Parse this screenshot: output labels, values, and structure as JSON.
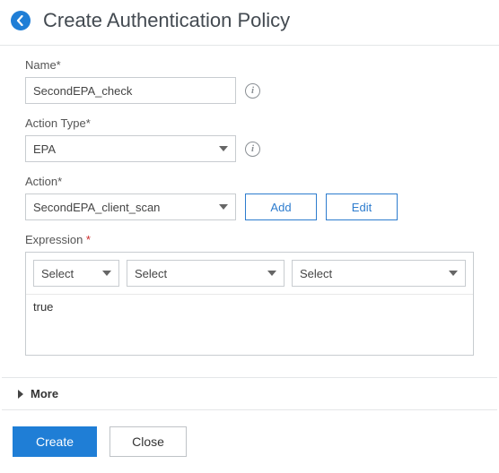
{
  "header": {
    "title": "Create Authentication Policy"
  },
  "fields": {
    "name": {
      "label": "Name*",
      "value": "SecondEPA_check"
    },
    "action_type": {
      "label": "Action Type*",
      "selected": "EPA",
      "options": [
        "EPA"
      ]
    },
    "action": {
      "label": "Action*",
      "selected": "SecondEPA_client_scan",
      "options": [
        "SecondEPA_client_scan"
      ],
      "add_btn": "Add",
      "edit_btn": "Edit"
    }
  },
  "expression": {
    "label": "Expression ",
    "sel1": {
      "placeholder": "Select",
      "options": [
        "Select"
      ]
    },
    "sel2": {
      "placeholder": "Select",
      "options": [
        "Select"
      ]
    },
    "sel3": {
      "placeholder": "Select",
      "options": [
        "Select"
      ]
    },
    "text": "true"
  },
  "more": {
    "label": "More"
  },
  "footer": {
    "create": "Create",
    "close": "Close"
  },
  "info_glyph": "i"
}
